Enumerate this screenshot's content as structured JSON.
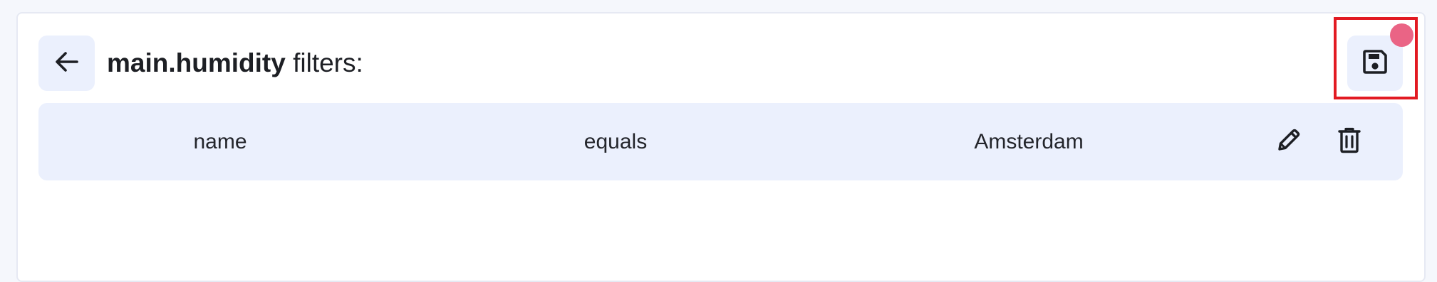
{
  "header": {
    "field_name": "main.humidity",
    "title_suffix": " filters:",
    "back_icon": "arrow-left-icon",
    "save_icon": "floppy-disk-icon"
  },
  "filters": [
    {
      "field": "name",
      "operator": "equals",
      "value": "Amsterdam",
      "actions": [
        "pencil-icon",
        "trash-icon"
      ]
    }
  ],
  "colors": {
    "unsaved_indicator": "#ea6485",
    "highlight": "#e21a22",
    "button_bg": "#ebf0fd",
    "row_bg": "#ebf0fd"
  }
}
